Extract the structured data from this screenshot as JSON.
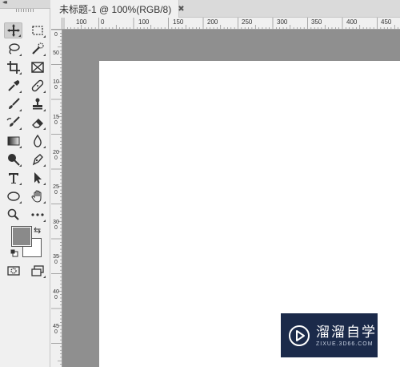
{
  "toolbox": {
    "collapse_arrows": "◂◂",
    "tools": [
      {
        "name": "move-tool",
        "icon": "move-icon",
        "active": true
      },
      {
        "name": "marquee-tool",
        "icon": "rect-marquee-icon"
      },
      {
        "name": "lasso-tool",
        "icon": "lasso-icon"
      },
      {
        "name": "quick-select-tool",
        "icon": "quick-select-icon"
      },
      {
        "name": "crop-tool",
        "icon": "crop-icon"
      },
      {
        "name": "frame-tool",
        "icon": "frame-icon"
      },
      {
        "name": "eyedropper-tool",
        "icon": "eyedropper-icon"
      },
      {
        "name": "healing-tool",
        "icon": "bandage-icon"
      },
      {
        "name": "brush-tool",
        "icon": "brush-icon"
      },
      {
        "name": "stamp-tool",
        "icon": "stamp-icon"
      },
      {
        "name": "history-brush-tool",
        "icon": "history-brush-icon"
      },
      {
        "name": "eraser-tool",
        "icon": "eraser-icon"
      },
      {
        "name": "gradient-tool",
        "icon": "gradient-icon"
      },
      {
        "name": "blur-tool",
        "icon": "drop-icon"
      },
      {
        "name": "dodge-tool",
        "icon": "dodge-icon"
      },
      {
        "name": "pen-tool",
        "icon": "pen-icon"
      },
      {
        "name": "type-tool",
        "icon": "type-icon"
      },
      {
        "name": "path-select-tool",
        "icon": "arrow-icon"
      },
      {
        "name": "shape-tool",
        "icon": "ellipse-icon"
      },
      {
        "name": "hand-tool",
        "icon": "hand-icon"
      },
      {
        "name": "zoom-tool",
        "icon": "zoom-icon"
      },
      {
        "name": "more-tools",
        "icon": "ellipsis-icon"
      }
    ],
    "foreground_color": "#8a8a8a",
    "background_color": "#ffffff",
    "swap_glyph": "⇆"
  },
  "document": {
    "tab_title": "未标题-1 @ 100%(RGB/8)",
    "close_glyph": "✖"
  },
  "ruler_top": {
    "labels": [
      "100",
      "0",
      "100",
      "150",
      "200",
      "250",
      "300",
      "350",
      "400",
      "450"
    ]
  },
  "ruler_left": {
    "labels": [
      "0",
      "50",
      "100",
      "150",
      "200",
      "250",
      "300",
      "350",
      "400",
      "450"
    ]
  },
  "watermark": {
    "title": "溜溜自学",
    "subtitle": "ZIXUE.3D66.COM"
  }
}
